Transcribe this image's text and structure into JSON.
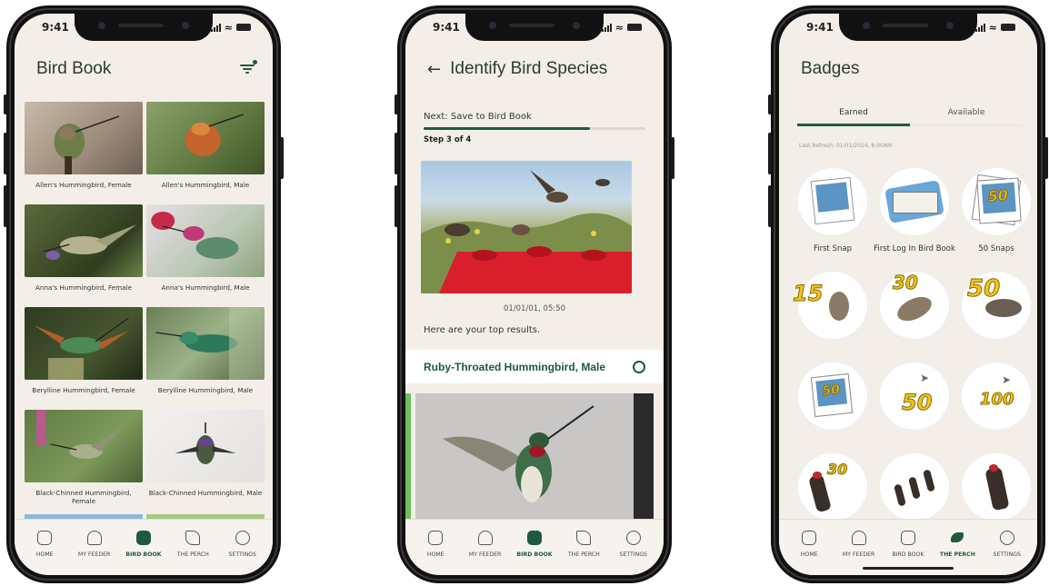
{
  "status_time": "9:41",
  "colors": {
    "accent": "#1f5a3e",
    "background": "#f3efe8"
  },
  "bird_book": {
    "title": "Bird Book",
    "filter_icon": "filter-icon",
    "birds": [
      "Allen's Hummingbird, Female",
      "Allen's Hummingbird, Male",
      "Anna's Hummingbird, Female",
      "Anna's Hummingbird, Male",
      "Berylline Hummingbird, Female",
      "Berylline Hummingbird, Male",
      "Black-Chinned Hummingbird, Female",
      "Black-Chinned Hummingbird, Male"
    ]
  },
  "identify": {
    "title": "Identify Bird Species",
    "next_step": "Next: Save to Bird Book",
    "step": "Step 3 of 4",
    "progress": 0.75,
    "timestamp": "01/01/01, 05:50",
    "top_results": "Here are your top results.",
    "result_name": "Ruby-Throated Hummingbird, Male"
  },
  "badges": {
    "title": "Badges",
    "tab_earned": "Earned",
    "tab_available": "Available",
    "last_refresh": "Last Refresh: 01/01/2024, 8:00AM",
    "labels": [
      "First Snap",
      "First Log In Bird Book",
      "50 Snaps"
    ],
    "numbers": [
      "50",
      "15",
      "30",
      "50",
      "50",
      "50",
      "100",
      "30"
    ]
  },
  "nav": {
    "home": "HOME",
    "my_feeder": "MY FEEDER",
    "bird_book": "BIRD BOOK",
    "the_perch": "THE PERCH",
    "settings": "SETTINGS"
  }
}
